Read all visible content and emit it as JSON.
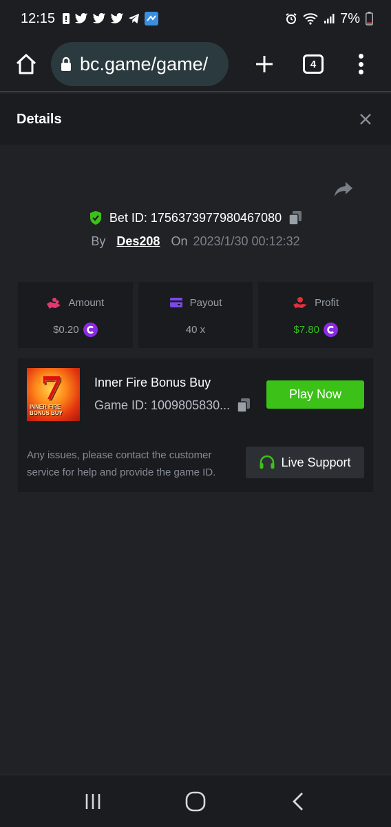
{
  "status_bar": {
    "time": "12:15",
    "battery_percent": "7%",
    "left_icons": [
      "notification-icon",
      "twitter-icon",
      "twitter-icon",
      "twitter-icon",
      "telegram-icon",
      "app-icon"
    ],
    "right_icons": [
      "alarm-icon",
      "wifi-icon",
      "signal-icon",
      "battery-icon"
    ]
  },
  "browser": {
    "url": "bc.game/game/",
    "tab_count": "4"
  },
  "details": {
    "title": "Details"
  },
  "bet": {
    "id_label": "Bet ID: 1756373977980467080",
    "by_label": "By",
    "user": "Des208",
    "on_label": "On",
    "date": "2023/1/30 00:12:32"
  },
  "stats": [
    {
      "label": "Amount",
      "value": "$0.20",
      "icon": "coins-hand-icon",
      "color": "#e23a6e"
    },
    {
      "label": "Payout",
      "value": "40 x",
      "icon": "wallet-icon",
      "color": "#7b49e8"
    },
    {
      "label": "Profit",
      "value": "$7.80",
      "icon": "profit-hand-icon",
      "color": "#e0303a"
    }
  ],
  "game": {
    "name": "Inner Fire Bonus Buy",
    "id_text": "Game ID: 1009805830...",
    "thumb_title": "INNER FIRE\nBONUS BUY",
    "play_label": "Play Now",
    "issues_text": "Any issues, please contact the customer service for help and provide the game ID.",
    "support_label": "Live Support"
  },
  "colors": {
    "accent_green": "#3bc117",
    "profit_green": "#33c01c",
    "coin_purple": "#8a2be2",
    "background": "#202226"
  }
}
